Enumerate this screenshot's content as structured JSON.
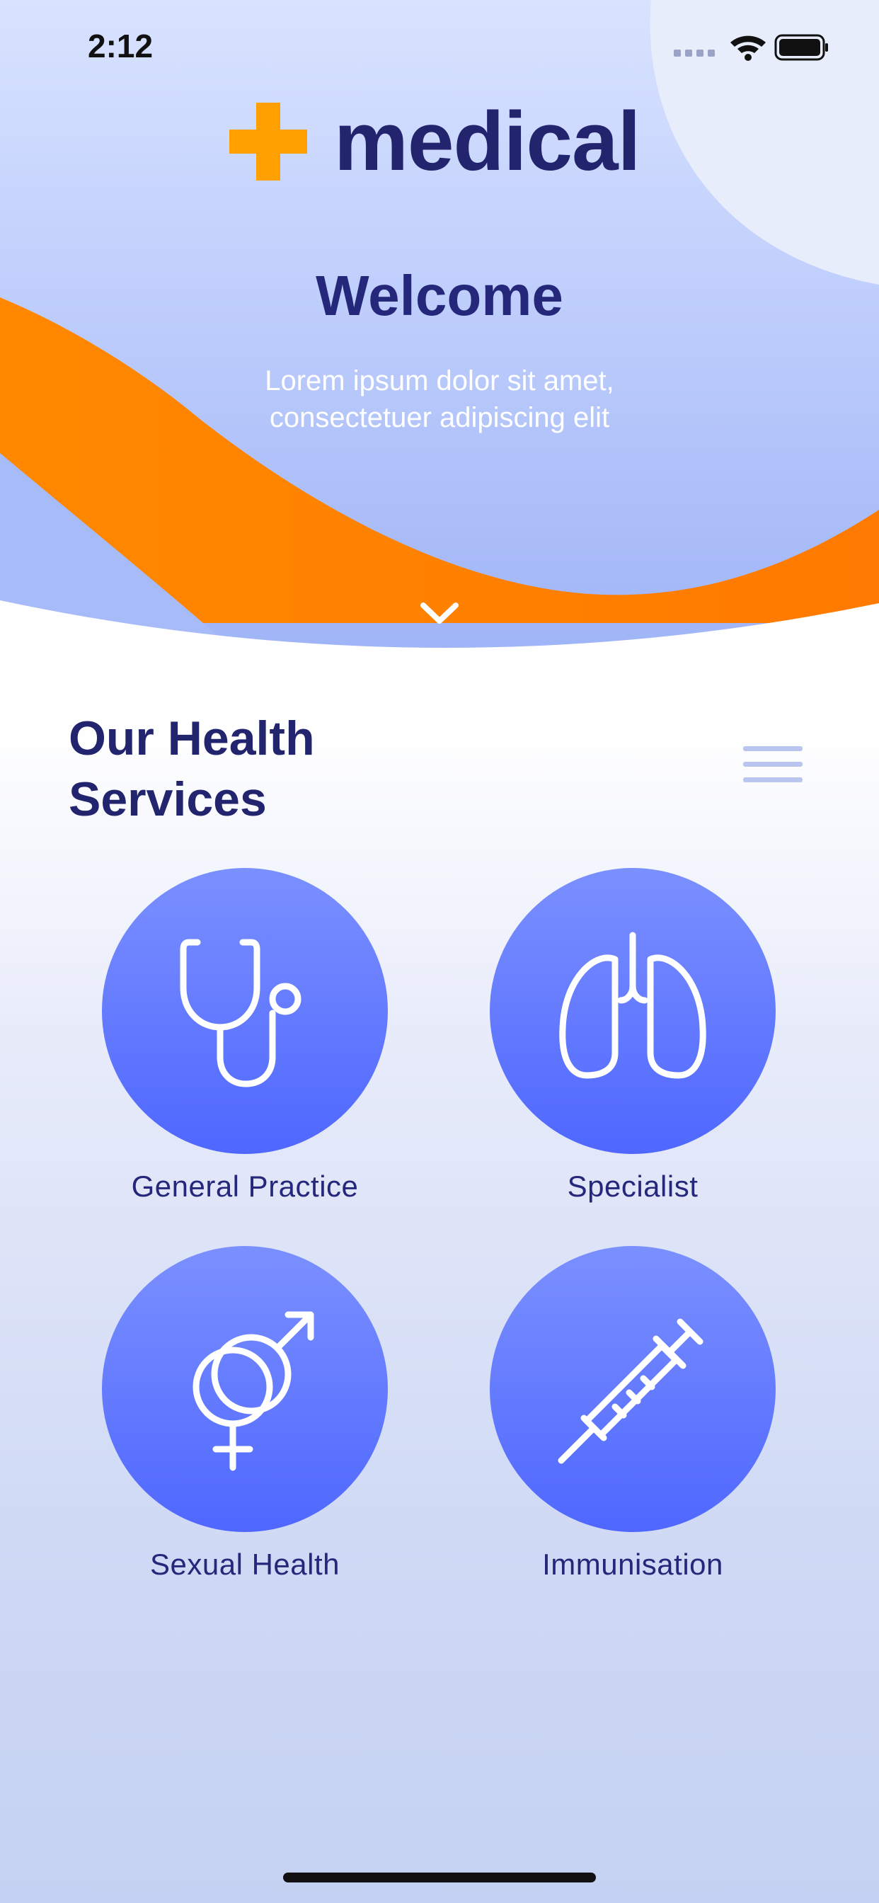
{
  "status_bar": {
    "time": "2:12"
  },
  "brand": {
    "name": "medical",
    "accent_color": "#ff8a00",
    "text_color": "#22246e"
  },
  "hero": {
    "title": "Welcome",
    "subtitle_line1": "Lorem ipsum dolor sit amet,",
    "subtitle_line2": "consectetuer adipiscing elit"
  },
  "services_section": {
    "title_line1": "Our Health",
    "title_line2": "Services",
    "items": [
      {
        "label": "General Practice",
        "icon": "stethoscope-icon"
      },
      {
        "label": "Specialist",
        "icon": "lungs-icon"
      },
      {
        "label": "Sexual Health",
        "icon": "gender-symbols-icon"
      },
      {
        "label": "Immunisation",
        "icon": "syringe-icon"
      }
    ]
  },
  "colors": {
    "circle_top": "#7b90ff",
    "circle_bottom": "#4f67ff",
    "menu": "#b9c5ee"
  }
}
